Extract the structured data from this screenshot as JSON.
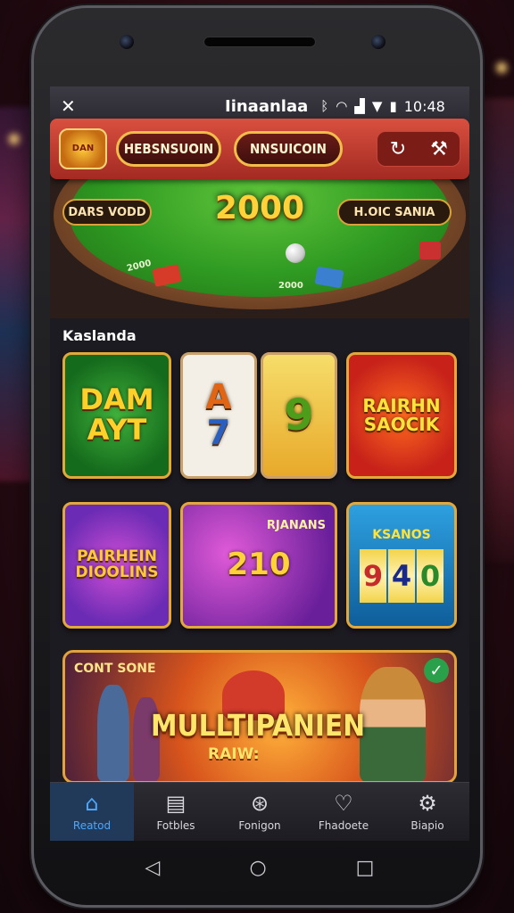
{
  "status_bar": {
    "left_icon": "x-icon",
    "carrier": "Iinaanlaa",
    "time": "10:48"
  },
  "header": {
    "logo_text": "DAN",
    "button_1": "HEBSNSUOIN",
    "button_2": "NNSUICOIN",
    "tools": [
      "refresh-icon",
      "tools-icon"
    ]
  },
  "table": {
    "left_label": "DARS VODD",
    "jackpot": "2000",
    "right_label": "H.OIC SANIA",
    "felt_labels": [
      "2000",
      "2000"
    ]
  },
  "section": {
    "title": "Kaslanda"
  },
  "games": [
    {
      "title": "DAM AYT"
    },
    {
      "title": "A",
      "subtitle": "7"
    },
    {
      "title": "9"
    },
    {
      "title": "RAIRHN SAOCIK"
    },
    {
      "title": "PAIRHEIN DIOOLINS"
    },
    {
      "title": "210",
      "subtitle": "RJANANS"
    },
    {
      "header": "KSANOS",
      "reels": [
        "9",
        "4",
        "0"
      ]
    }
  ],
  "banner": {
    "top_label": "CONT SONE",
    "title": "MULLTIPANIEN",
    "subtitle": "RAIW:"
  },
  "bottom_nav": [
    {
      "label": "Reatod",
      "icon": "home-icon",
      "active": true
    },
    {
      "label": "Fotbles",
      "icon": "list-icon",
      "active": false
    },
    {
      "label": "Fonigon",
      "icon": "chip-icon",
      "active": false
    },
    {
      "label": "Fhadoete",
      "icon": "heart-icon",
      "active": false
    },
    {
      "label": "Biapio",
      "icon": "gear-icon",
      "active": false
    }
  ],
  "colors": {
    "header_red": "#c0392b",
    "gold_border": "#e3a83a",
    "active_tab": "#4aa8ff",
    "felt_green": "#2f9a22"
  }
}
